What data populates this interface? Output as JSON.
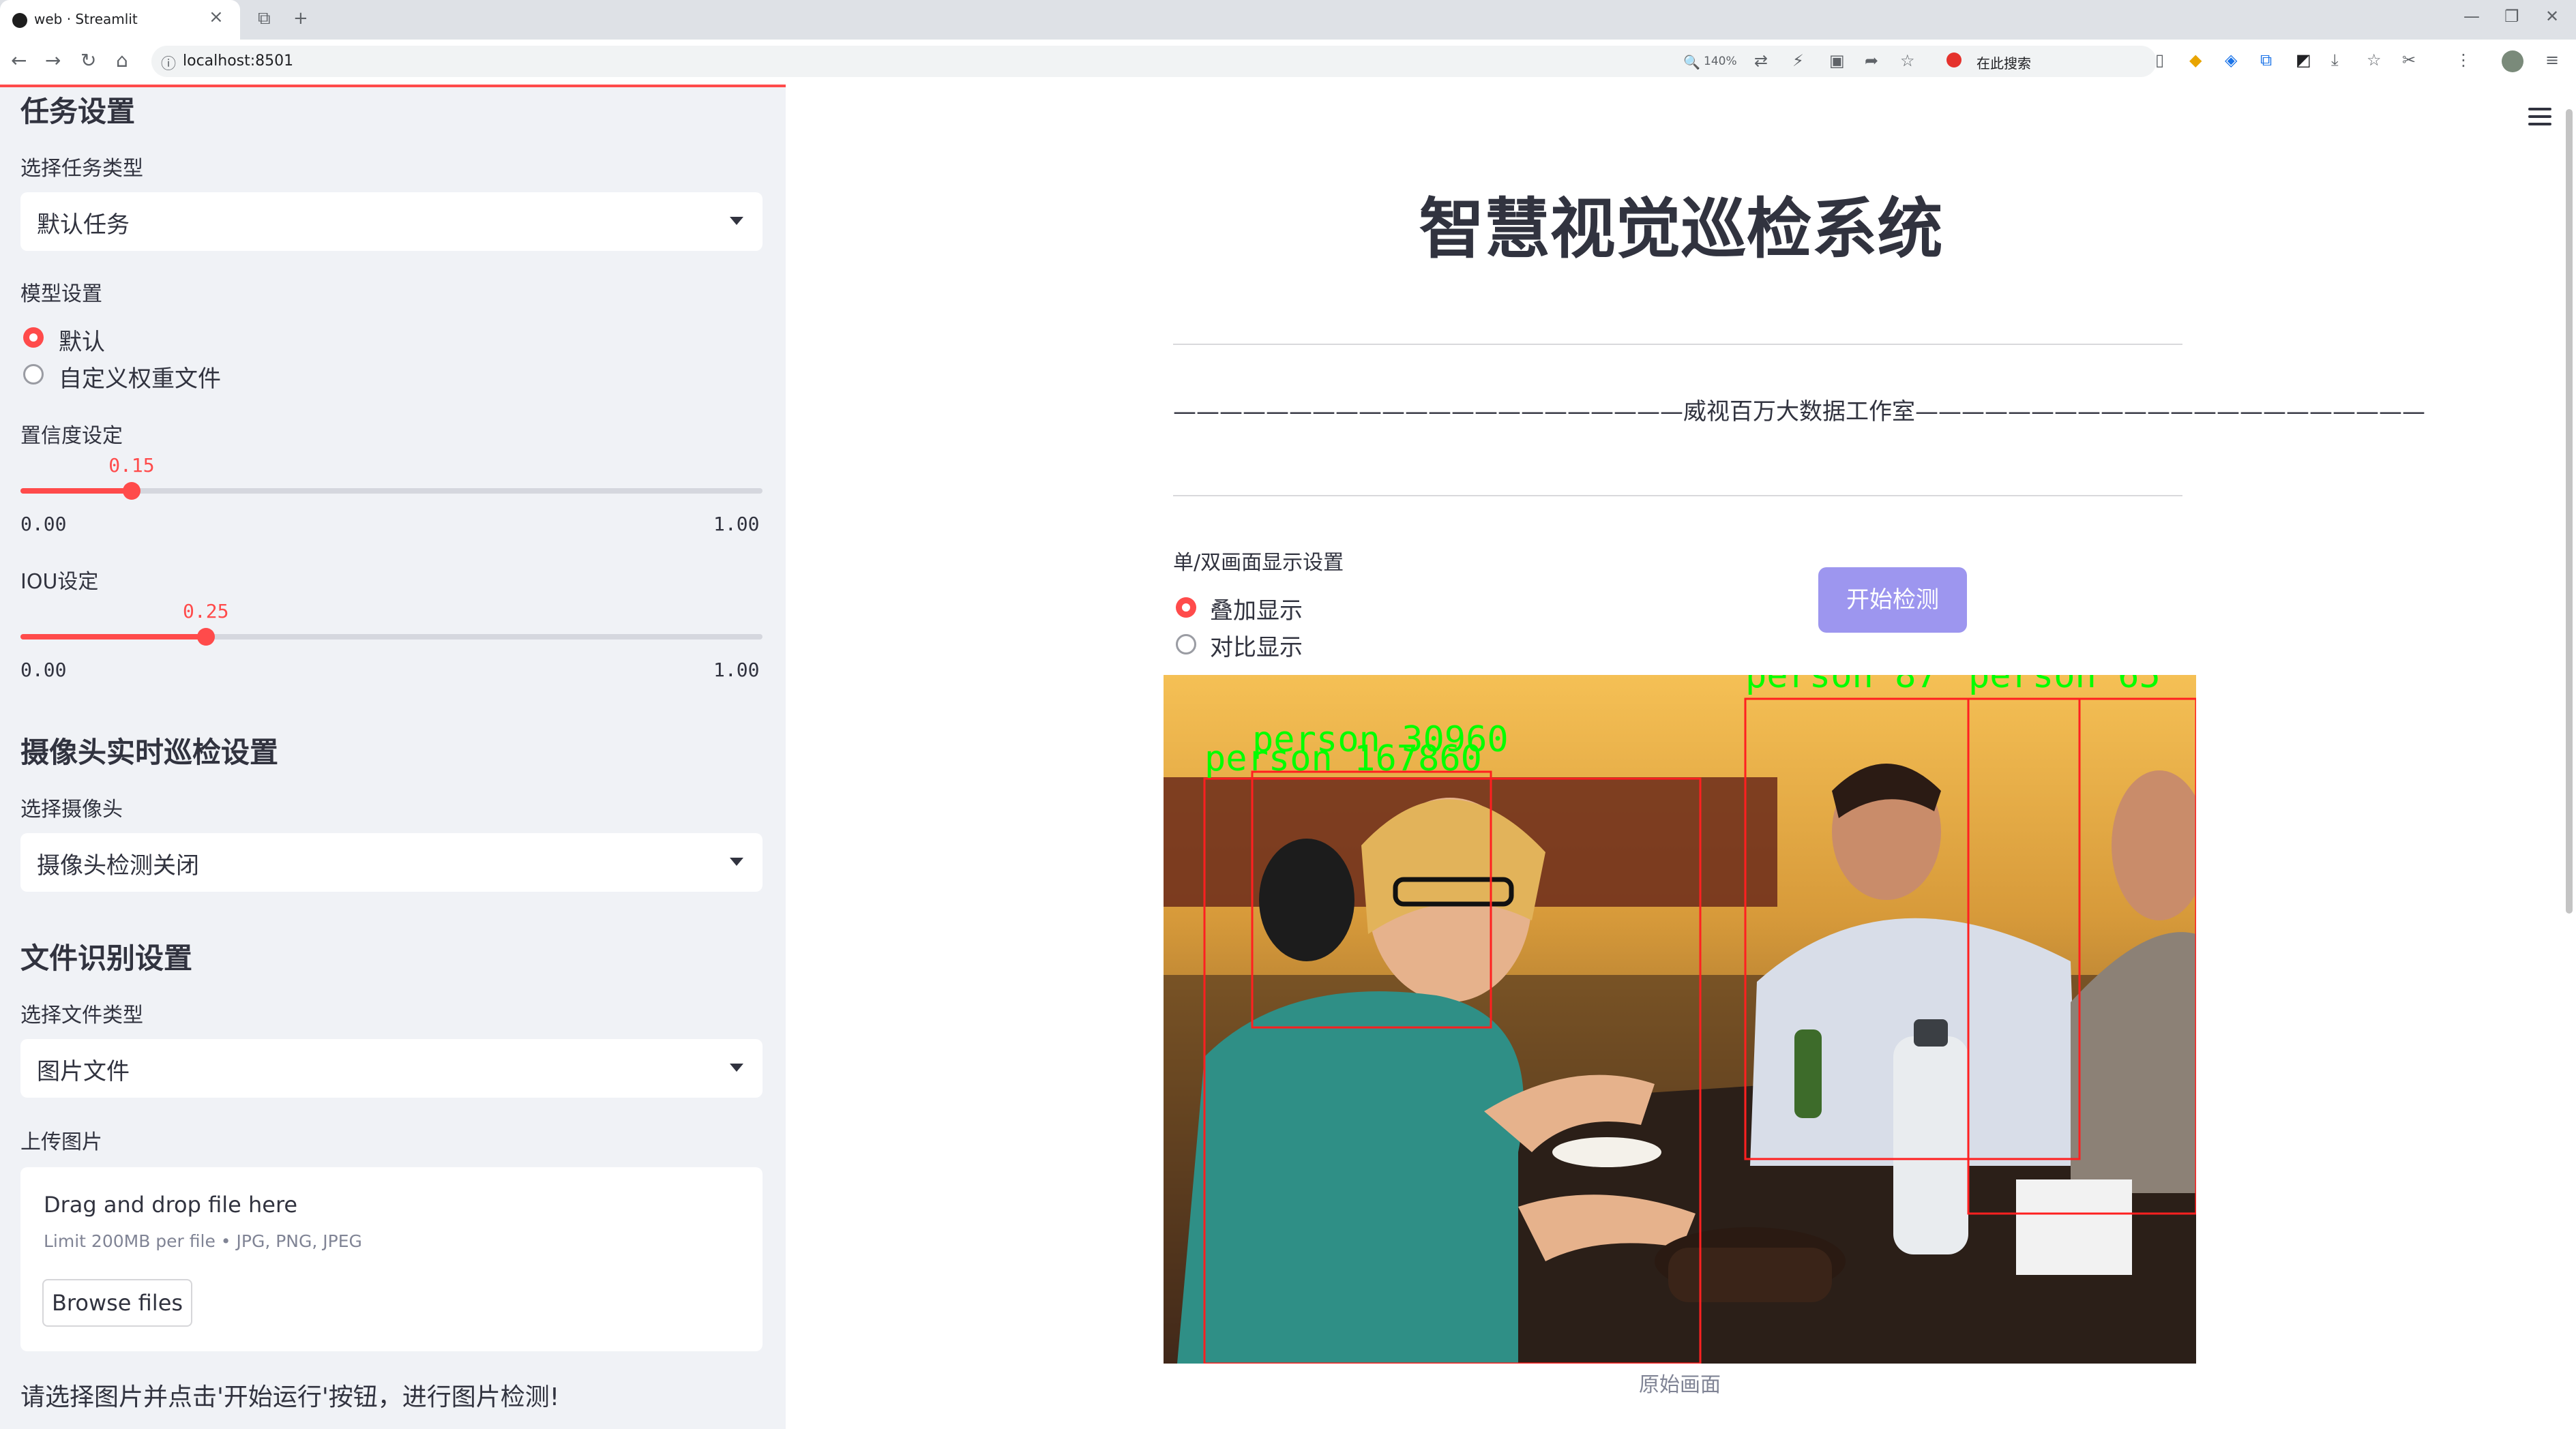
{
  "browser": {
    "tab_title": "web · Streamlit",
    "url": "localhost:8501",
    "zoom": "140%",
    "search_placeholder": "在此搜索"
  },
  "sidebar": {
    "task_section": {
      "heading": "任务设置",
      "task_type_label": "选择任务类型",
      "task_type_value": "默认任务"
    },
    "model_section": {
      "label": "模型设置",
      "options": [
        {
          "label": "默认",
          "selected": true
        },
        {
          "label": "自定义权重文件",
          "selected": false
        }
      ]
    },
    "confidence": {
      "label": "置信度设定",
      "value": "0.15",
      "value_num": 0.15,
      "min": "0.00",
      "max": "1.00"
    },
    "iou": {
      "label": "IOU设定",
      "value": "0.25",
      "value_num": 0.25,
      "min": "0.00",
      "max": "1.00"
    },
    "camera_section": {
      "heading": "摄像头实时巡检设置",
      "label": "选择摄像头",
      "value": "摄像头检测关闭"
    },
    "file_section": {
      "heading": "文件识别设置",
      "file_type_label": "选择文件类型",
      "file_type_value": "图片文件",
      "upload_label": "上传图片",
      "drag_text": "Drag and drop file here",
      "limit_text": "Limit 200MB per file • JPG, PNG, JPEG",
      "browse_label": "Browse files"
    },
    "hint": "请选择图片并点击'开始运行'按钮，进行图片检测!"
  },
  "main": {
    "title": "智慧视觉巡检系统",
    "studio": "——————————————————————威视百万大数据工作室——————————————————————",
    "display": {
      "label": "单/双画面显示设置",
      "options": [
        {
          "label": "叠加显示",
          "selected": true
        },
        {
          "label": "对比显示",
          "selected": false
        }
      ]
    },
    "start_button": "开始检测",
    "image_caption": "原始画面",
    "detections": [
      {
        "label": "person 30960"
      },
      {
        "label": "person 167860"
      },
      {
        "label": "person 87"
      },
      {
        "label": "person 65"
      }
    ]
  },
  "colors": {
    "accent": "#ff4b4b",
    "sidebar_bg": "#f0f2f6",
    "button": "#9d96ef",
    "detection_box": "#ff2020",
    "detection_text": "#00ff00"
  }
}
